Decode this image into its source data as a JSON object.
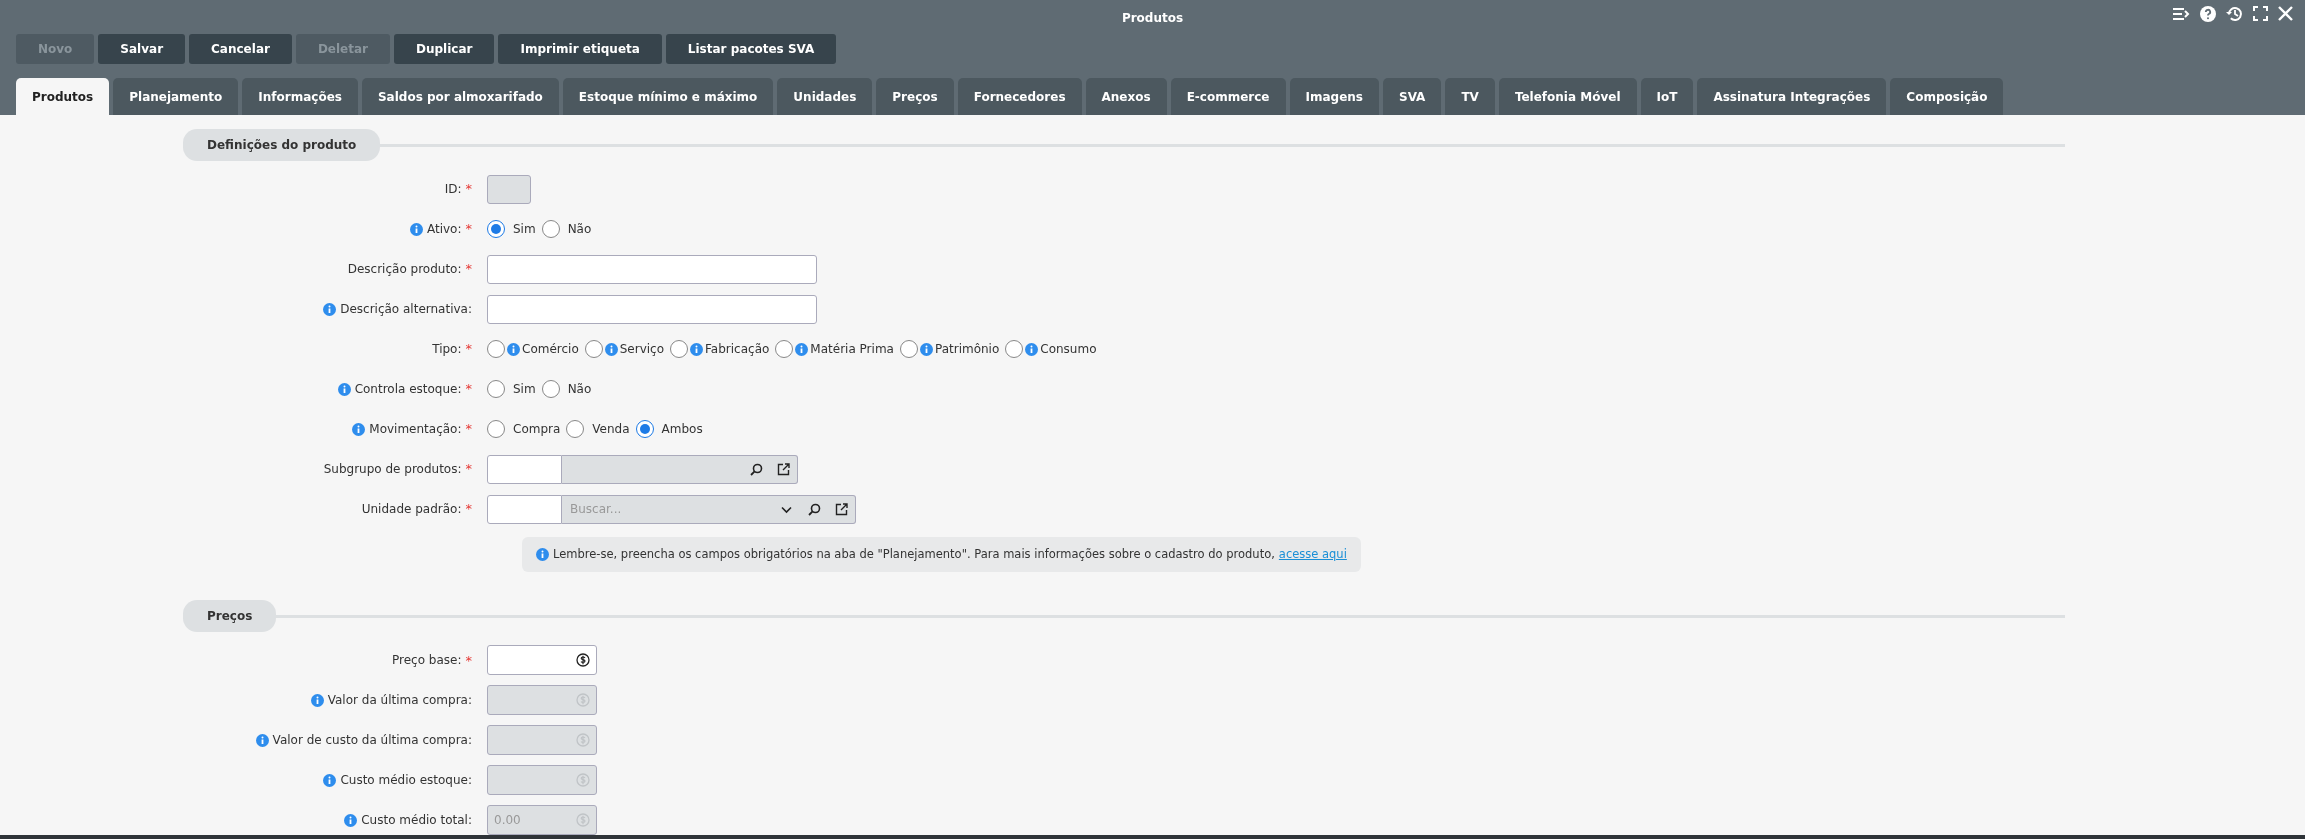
{
  "window": {
    "title": "Produtos"
  },
  "toolbar": [
    {
      "label": "Novo",
      "disabled": true
    },
    {
      "label": "Salvar",
      "disabled": false
    },
    {
      "label": "Cancelar",
      "disabled": false
    },
    {
      "label": "Deletar",
      "disabled": true
    },
    {
      "label": "Duplicar",
      "disabled": false
    },
    {
      "label": "Imprimir etiqueta",
      "disabled": false
    },
    {
      "label": "Listar pacotes SVA",
      "disabled": false
    }
  ],
  "tabs": [
    {
      "label": "Produtos",
      "selected": true
    },
    {
      "label": "Planejamento",
      "selected": false
    },
    {
      "label": "Informações",
      "selected": false
    },
    {
      "label": "Saldos por almoxarifado",
      "selected": false
    },
    {
      "label": "Estoque mínimo e máximo",
      "selected": false
    },
    {
      "label": "Unidades",
      "selected": false
    },
    {
      "label": "Preços",
      "selected": false
    },
    {
      "label": "Fornecedores",
      "selected": false
    },
    {
      "label": "Anexos",
      "selected": false
    },
    {
      "label": "E-commerce",
      "selected": false
    },
    {
      "label": "Imagens",
      "selected": false
    },
    {
      "label": "SVA",
      "selected": false
    },
    {
      "label": "TV",
      "selected": false
    },
    {
      "label": "Telefonia Móvel",
      "selected": false
    },
    {
      "label": "IoT",
      "selected": false
    },
    {
      "label": "Assinatura Integrações",
      "selected": false
    },
    {
      "label": "Composição",
      "selected": false
    }
  ],
  "sections": [
    {
      "title": "Definições do produto",
      "fields": [
        {
          "kind": "short",
          "label": "ID:",
          "required_mark": "*",
          "info": false,
          "disabled": true
        },
        {
          "kind": "radio",
          "label": "Ativo:",
          "required_mark": "*",
          "info": true,
          "options": [
            {
              "label": "Sim",
              "info": false,
              "selected": true
            },
            {
              "label": "Não",
              "info": false,
              "selected": false
            }
          ]
        },
        {
          "kind": "text",
          "label": "Descrição produto:",
          "required_mark": "*",
          "info": false,
          "disabled": false
        },
        {
          "kind": "text",
          "label": "Descrição alternativa:",
          "info": true,
          "disabled": false
        },
        {
          "kind": "radio",
          "label": "Tipo:",
          "required_mark": "*",
          "info": false,
          "options": [
            {
              "label": "Comércio",
              "info": true,
              "selected": false
            },
            {
              "label": "Serviço",
              "info": true,
              "selected": false
            },
            {
              "label": "Fabricação",
              "info": true,
              "selected": false
            },
            {
              "label": "Matéria Prima",
              "info": true,
              "selected": false
            },
            {
              "label": "Patrimônio",
              "info": true,
              "selected": false
            },
            {
              "label": "Consumo",
              "info": true,
              "selected": false
            }
          ]
        },
        {
          "kind": "radio",
          "label": "Controla estoque:",
          "required_mark": "*",
          "info": true,
          "options": [
            {
              "label": "Sim",
              "info": false,
              "selected": false
            },
            {
              "label": "Não",
              "info": false,
              "selected": false
            }
          ]
        },
        {
          "kind": "radio",
          "label": "Movimentação:",
          "required_mark": "*",
          "info": true,
          "options": [
            {
              "label": "Compra",
              "info": false,
              "selected": false
            },
            {
              "label": "Venda",
              "info": false,
              "selected": false
            },
            {
              "label": "Ambos",
              "info": false,
              "selected": true
            }
          ]
        },
        {
          "kind": "lookup",
          "label": "Subgrupo de produtos:",
          "required_mark": "*",
          "info": false,
          "dropdown": false
        },
        {
          "kind": "lookup",
          "label": "Unidade padrão:",
          "required_mark": "*",
          "info": false,
          "dropdown": true,
          "placeholder": "Buscar..."
        },
        {
          "kind": "note",
          "text": "Lembre-se, preencha os campos obrigatórios na aba de \"Planejamento\". Para mais informações sobre o cadastro do produto,",
          "link": "acesse aqui"
        }
      ]
    },
    {
      "title": "Preços",
      "fields": [
        {
          "kind": "money",
          "label": "Preço base:",
          "required_mark": "*",
          "info": false,
          "disabled": false
        },
        {
          "kind": "money",
          "label": "Valor da última compra:",
          "info": true,
          "disabled": true
        },
        {
          "kind": "money",
          "label": "Valor de custo da última compra:",
          "info": true,
          "disabled": true
        },
        {
          "kind": "money",
          "label": "Custo médio estoque:",
          "info": true,
          "disabled": true
        },
        {
          "kind": "money",
          "label": "Custo médio total:",
          "info": true,
          "disabled": true,
          "value": "0.00"
        }
      ]
    }
  ]
}
